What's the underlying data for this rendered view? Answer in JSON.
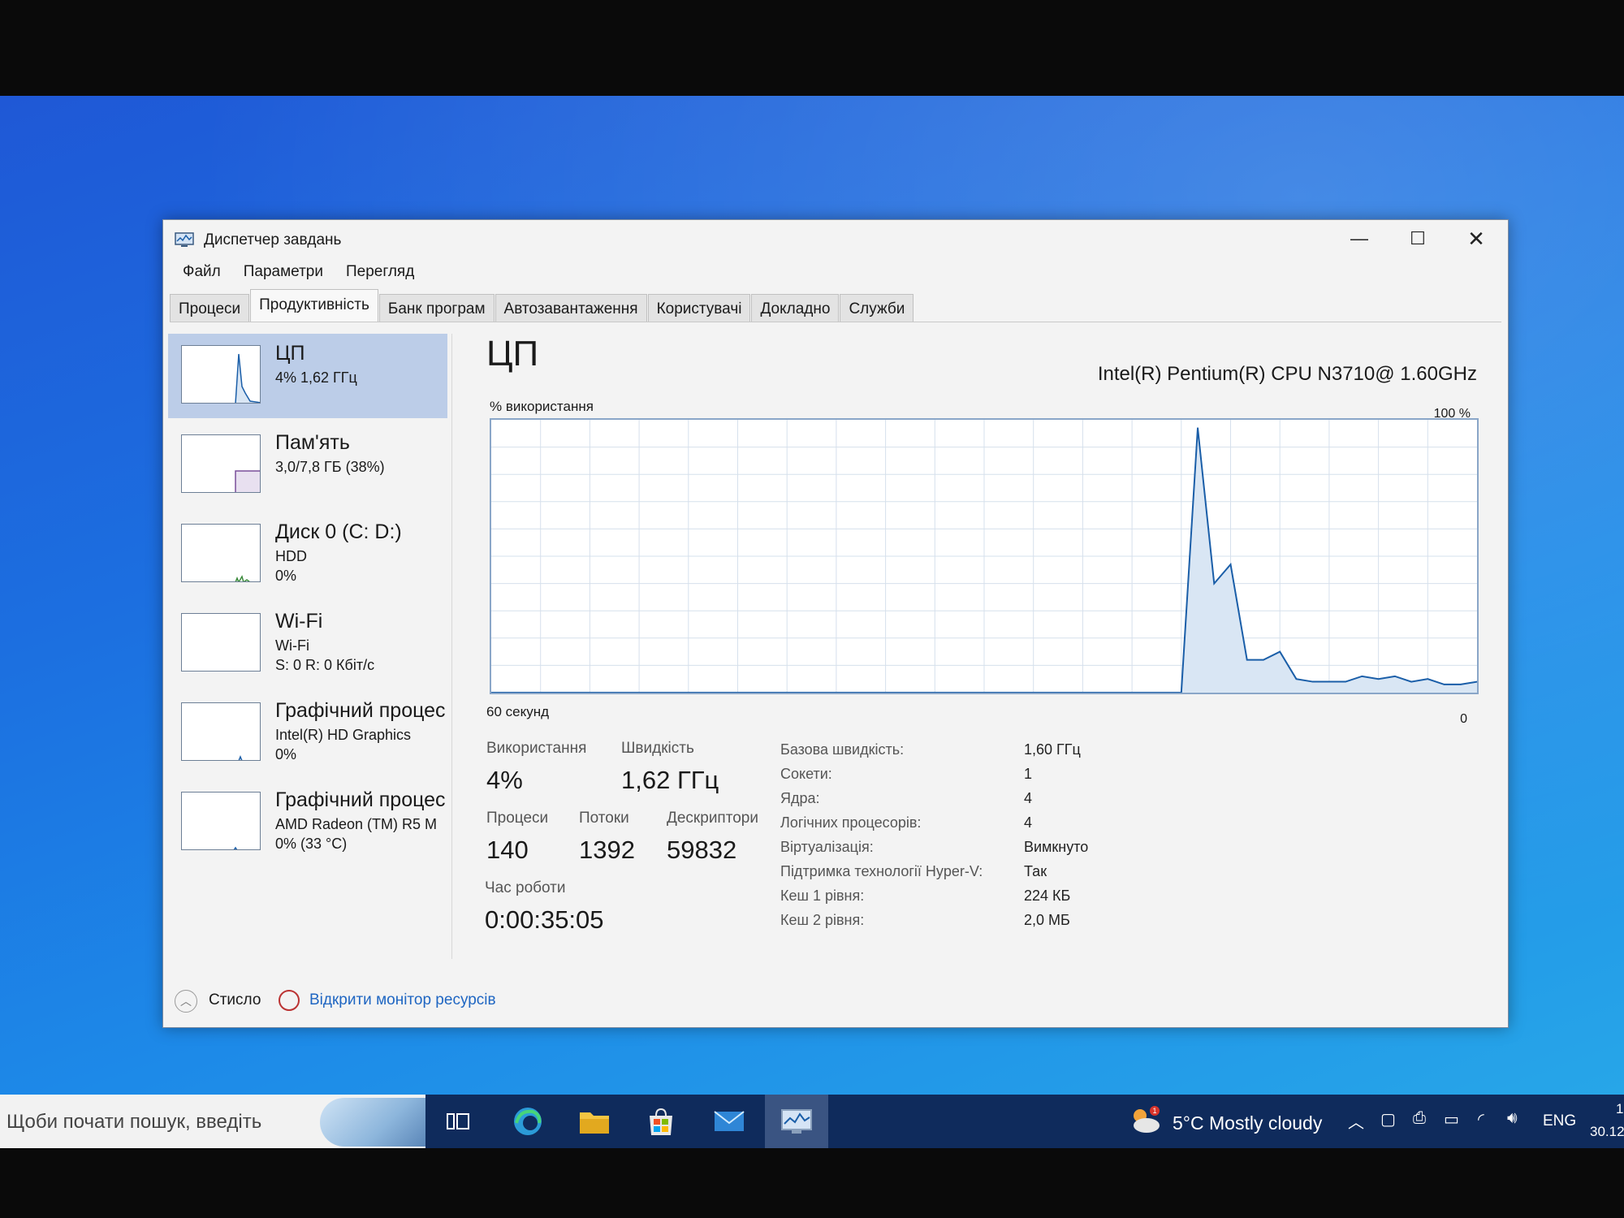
{
  "window": {
    "title": "Диспетчер завдань",
    "caption": {
      "minimize": "—",
      "maximize": "☐",
      "close": "✕"
    }
  },
  "menu": [
    "Файл",
    "Параметри",
    "Перегляд"
  ],
  "tabs": [
    "Процеси",
    "Продуктивність",
    "Банк програм",
    "Автозавантаження",
    "Користувачі",
    "Докладно",
    "Служби"
  ],
  "active_tab": "Продуктивність",
  "sidebar": [
    {
      "name": "ЦП",
      "line1": "4% 1,62 ГГц",
      "line2": ""
    },
    {
      "name": "Пам'ять",
      "line1": "3,0/7,8 ГБ (38%)",
      "line2": ""
    },
    {
      "name": "Диск 0 (C: D:)",
      "line1": "HDD",
      "line2": "0%"
    },
    {
      "name": "Wi-Fi",
      "line1": "Wi-Fi",
      "line2": "S: 0 R: 0 Кбіт/с"
    },
    {
      "name": "Графічний процес",
      "line1": "Intel(R) HD Graphics",
      "line2": "0%"
    },
    {
      "name": "Графічний процес",
      "line1": "AMD Radeon (TM) R5 M",
      "line2": "0% (33 °C)"
    }
  ],
  "main": {
    "heading": "ЦП",
    "model": "Intel(R) Pentium(R) CPU N3710@ 1.60GHz",
    "graph_label": "% використання",
    "graph_max": "100 %",
    "graph_xlabel": "60 секунд",
    "graph_zero": "0"
  },
  "chart_data": {
    "type": "area",
    "title": "",
    "ylabel": "% використання",
    "xlabel": "60 секунд",
    "xlim": [
      60,
      0
    ],
    "ylim": [
      0,
      100
    ],
    "grid": true,
    "x": [
      60,
      58,
      56,
      54,
      52,
      50,
      48,
      46,
      44,
      42,
      40,
      38,
      36,
      34,
      32,
      30,
      28,
      26,
      24,
      22,
      20,
      18,
      17,
      16,
      15,
      14,
      13,
      12,
      11,
      10,
      9,
      8,
      7,
      6,
      5,
      4,
      3,
      2,
      1,
      0
    ],
    "values": [
      0,
      0,
      0,
      0,
      0,
      0,
      0,
      0,
      0,
      0,
      0,
      0,
      0,
      0,
      0,
      0,
      0,
      0,
      0,
      0,
      0,
      0,
      97,
      40,
      47,
      12,
      12,
      15,
      5,
      4,
      4,
      4,
      6,
      5,
      6,
      4,
      5,
      3,
      3,
      4
    ]
  },
  "stats": {
    "usage_label": "Використання",
    "usage": "4%",
    "speed_label": "Швидкість",
    "speed": "1,62 ГГц",
    "processes_label": "Процеси",
    "processes": "140",
    "threads_label": "Потоки",
    "threads": "1392",
    "handles_label": "Дескриптори",
    "handles": "59832",
    "uptime_label": "Час роботи",
    "uptime": "0:00:35:05"
  },
  "info": [
    {
      "label": "Базова швидкість:",
      "value": "1,60 ГГц"
    },
    {
      "label": "Сокети:",
      "value": "1"
    },
    {
      "label": "Ядра:",
      "value": "4"
    },
    {
      "label": "Логічних процесорів:",
      "value": "4"
    },
    {
      "label": "Віртуалізація:",
      "value": "Вимкнуто"
    },
    {
      "label": "Підтримка технології Hyper-V:",
      "value": "Так"
    },
    {
      "label": "Кеш 1 рівня:",
      "value": "224 КБ"
    },
    {
      "label": "Кеш 2 рівня:",
      "value": "2,0 МБ"
    }
  ],
  "footer": {
    "fewer_details": "Стисло",
    "open_monitor": "Відкрити монітор ресурсів"
  },
  "taskbar": {
    "search_placeholder": "Щоби почати пошук, введіть",
    "weather": "5°C  Mostly cloudy",
    "weather_badge": "1",
    "language": "ENG",
    "clock_time": "1:",
    "clock_date": "30.12"
  },
  "colors": {
    "graph_line": "#1a5ea8",
    "graph_fill": "#d9e6f4",
    "graph_grid": "#d6e0ec",
    "sidebar_active": "#bccde8",
    "link": "#1f66c2"
  }
}
